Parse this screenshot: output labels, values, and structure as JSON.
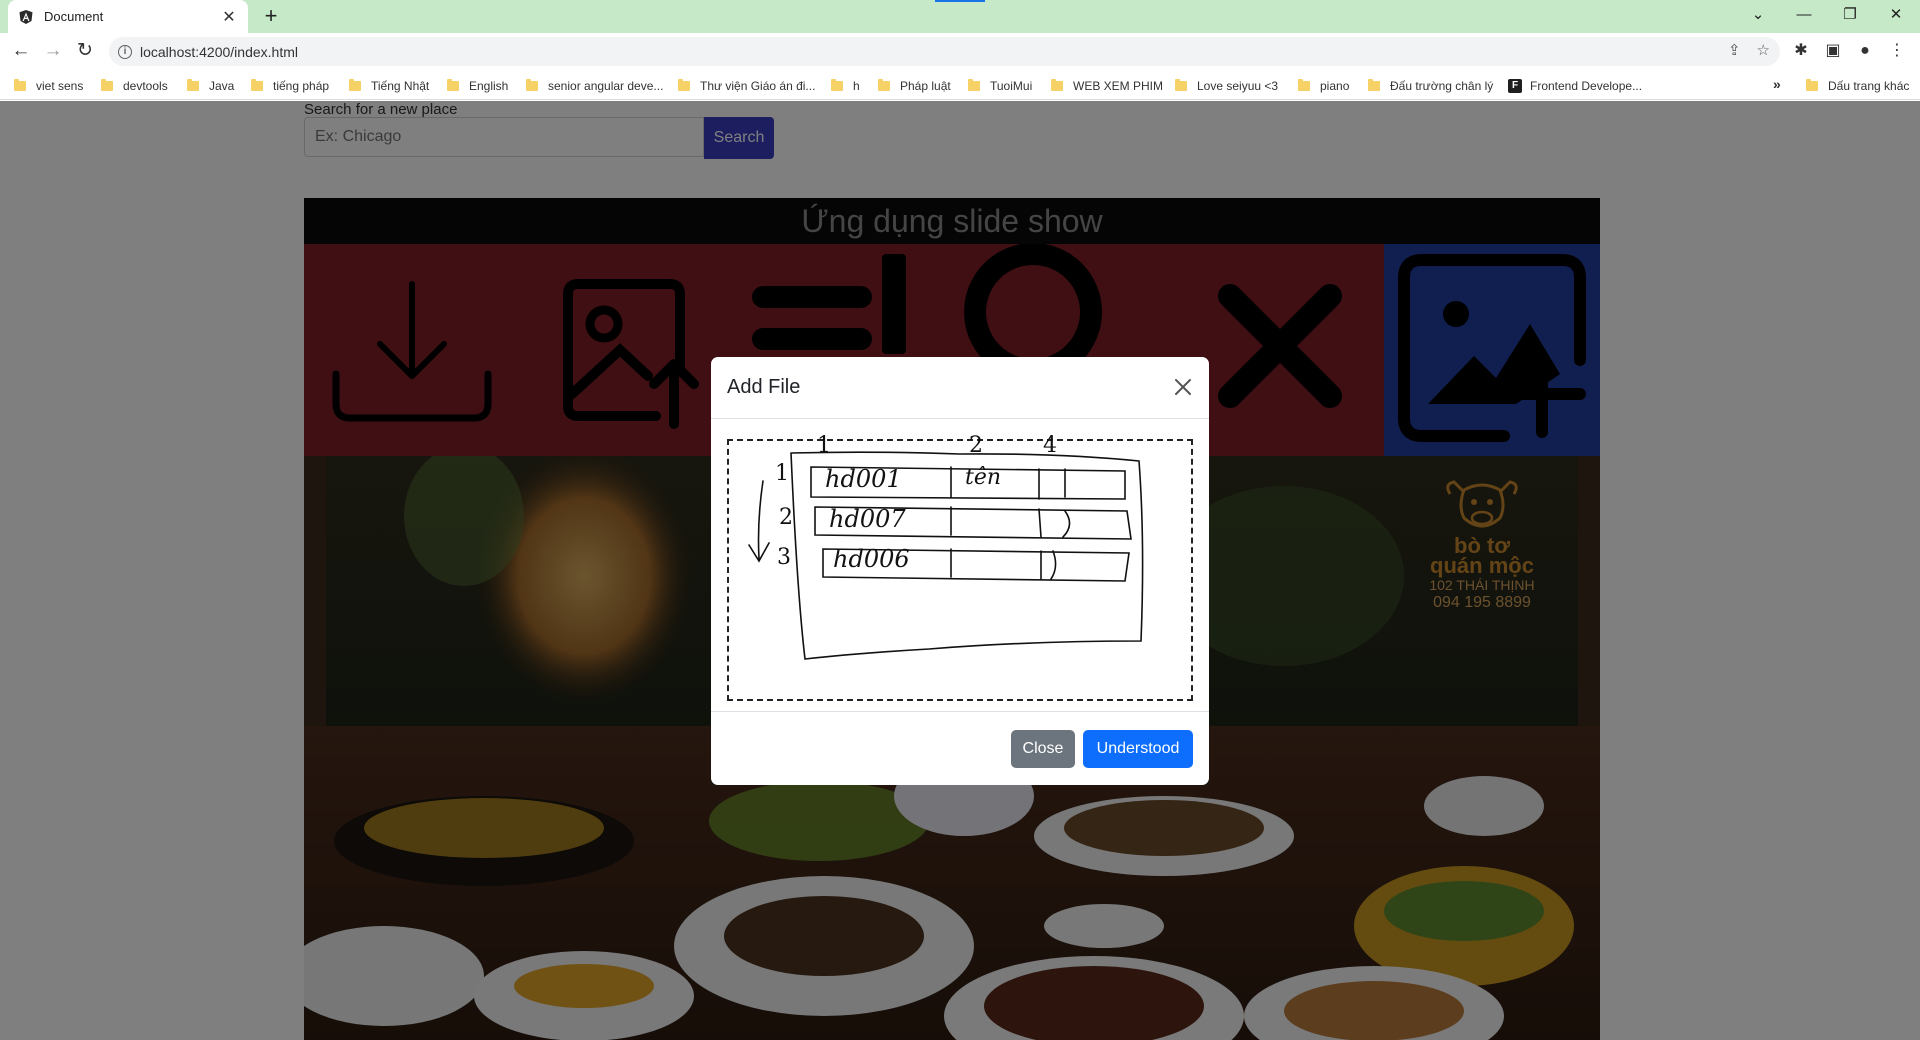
{
  "browser": {
    "tab": {
      "title": "Document",
      "favicon": "angular-icon"
    },
    "url": "localhost:4200/index.html",
    "bookmarks": [
      {
        "label": "viet sens",
        "icon": "folder-icon"
      },
      {
        "label": "devtools",
        "icon": "folder-icon"
      },
      {
        "label": "Java",
        "icon": "folder-icon"
      },
      {
        "label": "tiếng pháp",
        "icon": "folder-icon"
      },
      {
        "label": "Tiếng Nhật",
        "icon": "folder-icon"
      },
      {
        "label": "English",
        "icon": "folder-icon"
      },
      {
        "label": "senior angular deve...",
        "icon": "folder-icon"
      },
      {
        "label": "Thư viện Giáo án đi...",
        "icon": "folder-icon"
      },
      {
        "label": "h",
        "icon": "folder-icon"
      },
      {
        "label": "Pháp luật",
        "icon": "folder-icon"
      },
      {
        "label": "TuoiMui",
        "icon": "folder-icon"
      },
      {
        "label": "WEB XEM PHIM",
        "icon": "folder-icon"
      },
      {
        "label": "Love seiyuu <3",
        "icon": "folder-icon"
      },
      {
        "label": "piano",
        "icon": "folder-icon"
      },
      {
        "label": "Đấu trường chân lý",
        "icon": "folder-icon"
      },
      {
        "label": "Frontend Develope...",
        "icon": "frontend-favicon"
      }
    ],
    "bookmarks_overflow": "»",
    "other_bookmarks": "Dấu trang khác"
  },
  "page": {
    "search_label": "Search for a new place",
    "search_placeholder": "Ex: Chicago",
    "search_button": "Search",
    "slideshow_title": "Ứng dụng slide show",
    "tools": [
      "download-icon",
      "image-upload-icon",
      "reorder-icon",
      "search-icon",
      "close-icon",
      "add-image-icon"
    ],
    "logo": {
      "line1": "bò tơ",
      "line2": "quán mộc",
      "address": "102 THÁI THỊNH",
      "phone": "094 195 8899"
    },
    "colors": {
      "tool_bar": "#7e1f26",
      "add_image_bg": "#223ea1",
      "search_button": "#3b3dbf"
    }
  },
  "modal": {
    "title": "Add File",
    "close_button": "Close",
    "confirm_button": "Understood",
    "sketch": {
      "column_numbers": [
        "1",
        "2",
        "4"
      ],
      "row_numbers": [
        "1",
        "2",
        "3"
      ],
      "rows": [
        {
          "code": "hd001",
          "name": "tên"
        },
        {
          "code": "hd007",
          "name": ""
        },
        {
          "code": "hd006",
          "name": ""
        }
      ]
    }
  }
}
